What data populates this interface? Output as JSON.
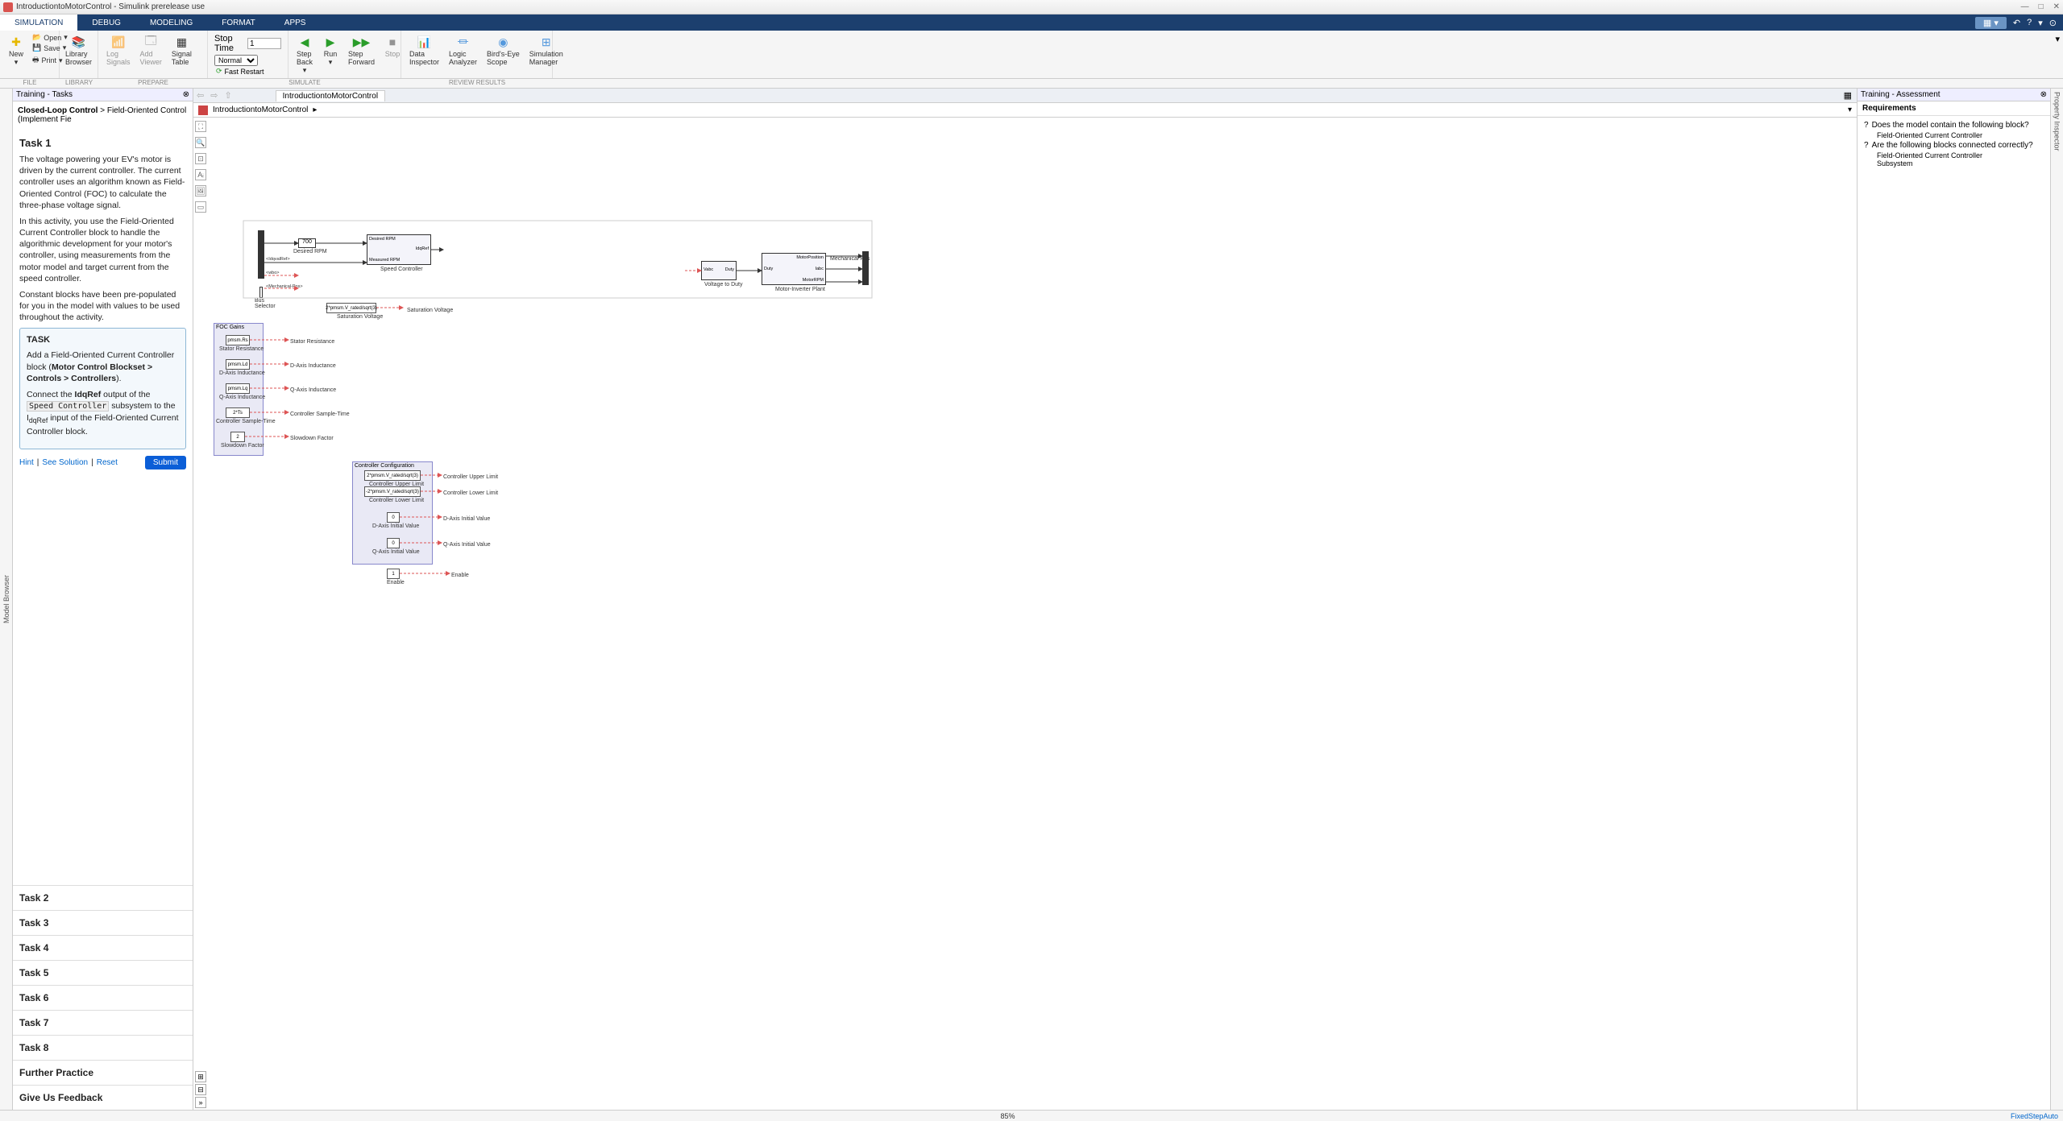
{
  "app": {
    "title": "IntroductiontoMotorControl - Simulink prerelease use"
  },
  "window_buttons": {
    "min": "—",
    "max": "□",
    "close": "✕"
  },
  "menubar": {
    "tabs": [
      "SIMULATION",
      "DEBUG",
      "MODELING",
      "FORMAT",
      "APPS"
    ],
    "active": 0
  },
  "toolstrip": {
    "file": {
      "new": "New",
      "open": "Open",
      "save": "Save",
      "print": "Print",
      "group": "FILE"
    },
    "library": {
      "label": "Library\nBrowser",
      "group": "LIBRARY"
    },
    "prepare": {
      "log": "Log\nSignals",
      "viewer": "Add\nViewer",
      "table": "Signal\nTable",
      "group": "PREPARE"
    },
    "simulate": {
      "stoptime_label": "Stop Time",
      "stoptime_value": "1",
      "mode": "Normal",
      "fast": "Fast Restart",
      "stepback": "Step\nBack",
      "run": "Run",
      "stepfwd": "Step\nForward",
      "stop": "Stop",
      "group": "SIMULATE"
    },
    "review": {
      "data": "Data\nInspector",
      "logic": "Logic\nAnalyzer",
      "birds": "Bird's-Eye\nScope",
      "mgr": "Simulation\nManager",
      "group": "REVIEW RESULTS"
    }
  },
  "leftdock": "Model Browser",
  "rightdock": "Property Inspector",
  "tasks": {
    "header": "Training - Tasks",
    "crumb1": "Closed-Loop Control",
    "crumb2": "Field-Oriented Control (Implement Fie",
    "t1_title": "Task 1",
    "p1": "The voltage powering your EV's motor is driven by the current controller. The current controller uses an algorithm known as Field-Oriented Control (FOC) to calculate the three-phase voltage signal.",
    "p2": "In this activity, you use the Field-Oriented Current Controller block to handle the algorithmic development for your motor's controller, using measurements from the motor model and target current from the speed controller.",
    "p3": "Constant blocks have been pre-populated for you in the model with values to be used throughout the activity.",
    "box": {
      "title": "TASK",
      "line1a": "Add a Field-Oriented Current Controller block (",
      "line1b": "Motor Control Blockset > Controls > Controllers",
      "line1c": ").",
      "line2a": "Connect the ",
      "line2b": "IdqRef",
      "line2c": " output of the ",
      "line2code": "Speed Controller",
      "line2d": " subsystem to the I",
      "line2sub": "dqRef",
      "line2e": " input of the Field-Oriented Current Controller block."
    },
    "actions": {
      "hint": "Hint",
      "see": "See Solution",
      "reset": "Reset",
      "submit": "Submit"
    },
    "list": [
      "Task 2",
      "Task 3",
      "Task 4",
      "Task 5",
      "Task 6",
      "Task 7",
      "Task 8",
      "Further Practice",
      "Give Us Feedback"
    ]
  },
  "canvas": {
    "tab": "IntroductiontoMotorControl",
    "crumb": "IntroductiontoMotorControl",
    "blocks": {
      "const700": "700",
      "desiredRPM": "Desired RPM",
      "speedctrl": "Speed Controller",
      "sc_in1": "Desired RPM",
      "sc_in2": "Measured RPM",
      "sc_out": "IdqRef",
      "busselector": "Bus\nSelector",
      "bus_out1": "<IdqvalRef>",
      "bus_out2": "<wbo>",
      "bus_out3": "<Mechanical-Pos>",
      "satv_expr": "2*pmsm.V_rated/sqrt(3)",
      "satv_lbl": "Saturation Voltage",
      "satv_out": "Saturation Voltage",
      "foc_group": "FOC Gains",
      "foc_rs": "pmsm.Rs",
      "foc_rs_lbl": "Stator Resistance",
      "foc_rs_out": "Stator Resistance",
      "foc_ld": "pmsm.Ld",
      "foc_ld_lbl": "D-Axis Inductance",
      "foc_ld_out": "D-Axis Inductance",
      "foc_lq": "pmsm.Lq",
      "foc_lq_lbl": "Q-Axis Inductance",
      "foc_lq_out": "Q-Axis Inductance",
      "foc_ts": "2*Ts",
      "foc_ts_lbl": "Controller Sample-Time",
      "foc_ts_out": "Controller Sample-Time",
      "foc_sd": "2",
      "foc_sd_lbl": "Slowdown Factor",
      "foc_sd_out": "Slowdown Factor",
      "cc_group": "Controller Configuration",
      "cc_up": "2*pmsm.V_rated/sqrt(3)",
      "cc_up_lbl": "Controller Upper Limit",
      "cc_up_out": "Controller Upper Limit",
      "cc_lo": "-2*pmsm.V_rated/sqrt(3)",
      "cc_lo_lbl": "Controller Lower Limit",
      "cc_lo_out": "Controller Lower Limit",
      "cc_d": "0",
      "cc_d_lbl": "D-Axis Initial Value",
      "cc_d_out": "D-Axis Initial Value",
      "cc_q": "0",
      "cc_q_lbl": "Q-Axis Initial Value",
      "cc_q_out": "Q-Axis Initial Value",
      "enable": "1",
      "enable_lbl": "Enable",
      "enable_out": "Enable",
      "v2d": "Voltage to Duty",
      "v2d_in": "Vabc",
      "v2d_out": "Duty",
      "mip": "Motor-Inverter Plant",
      "mip_in": "Duty",
      "mip_o1": "MotorPosition",
      "mip_o2": "Iabc",
      "mip_o3": "MotorRPM",
      "mechpos": "Mechanical Pos"
    }
  },
  "assessment": {
    "header": "Training - Assessment",
    "section": "Requirements",
    "req1": "Does the model contain the following block?",
    "req1_sub": "Field-Oriented Current Controller",
    "req2": "Are the following blocks connected correctly?",
    "req2_sub1": "Field-Oriented Current Controller",
    "req2_sub2": "Subsystem"
  },
  "status": {
    "zoom": "85%",
    "solver": "FixedStepAuto"
  }
}
